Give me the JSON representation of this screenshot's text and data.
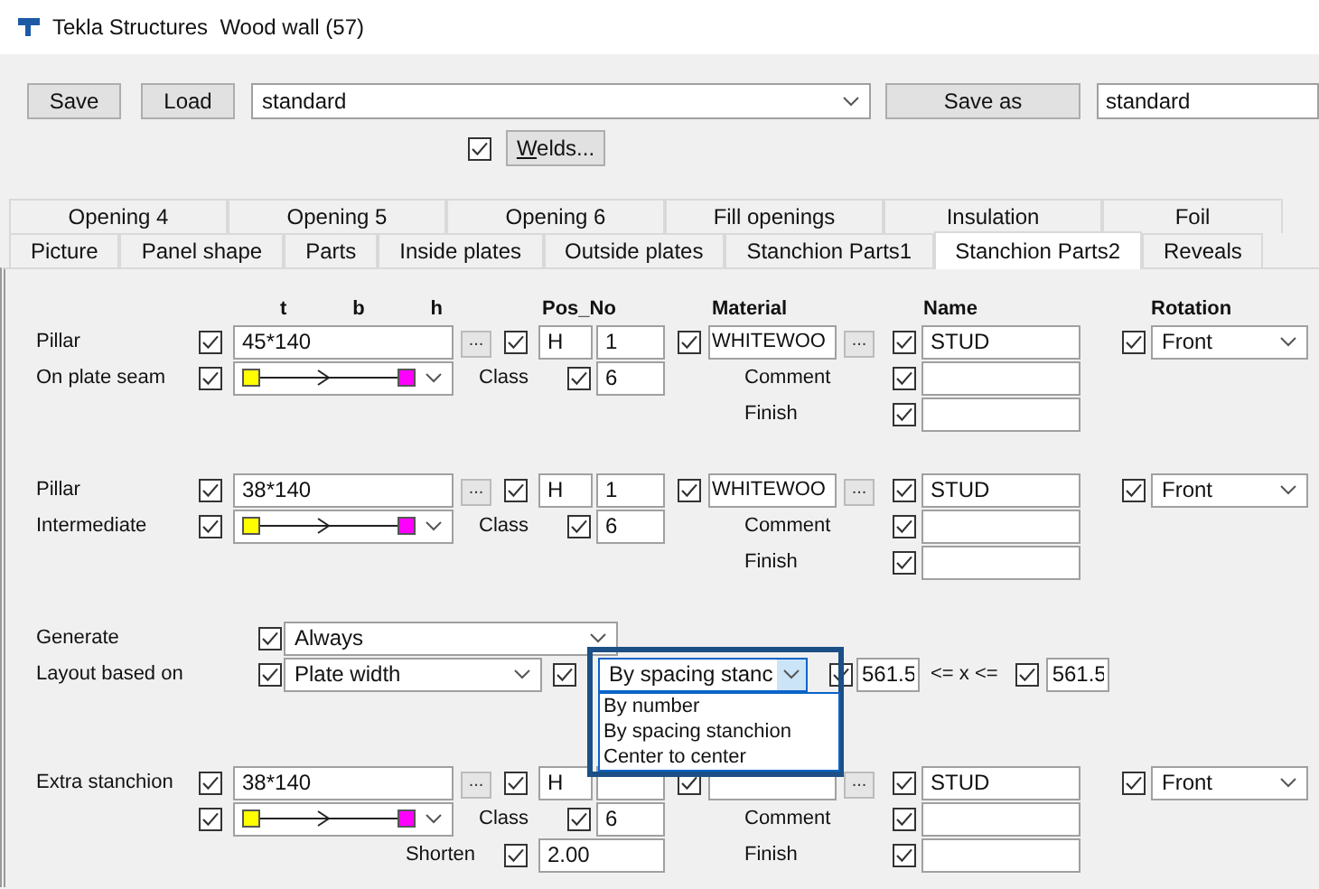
{
  "window": {
    "title": "Tekla Structures  Wood wall (57)"
  },
  "toolbar": {
    "save": "Save",
    "load": "Load",
    "preset": "standard",
    "save_as": "Save as",
    "save_as_name": "standard",
    "welds": {
      "checked": true,
      "label": "Welds..."
    }
  },
  "tab_rows": [
    {
      "tabs": [
        {
          "label": "Opening 4",
          "selected": false
        },
        {
          "label": "Opening 5",
          "selected": false
        },
        {
          "label": "Opening 6",
          "selected": false
        },
        {
          "label": "Fill openings",
          "selected": false
        },
        {
          "label": "Insulation",
          "selected": false
        },
        {
          "label": "Foil",
          "selected": false
        }
      ]
    },
    {
      "tabs": [
        {
          "label": "Picture",
          "selected": false
        },
        {
          "label": "Panel shape",
          "selected": false
        },
        {
          "label": "Parts",
          "selected": false
        },
        {
          "label": "Inside plates",
          "selected": false
        },
        {
          "label": "Outside plates",
          "selected": false
        },
        {
          "label": "Stanchion Parts1",
          "selected": false
        },
        {
          "label": "Stanchion Parts2",
          "selected": true
        },
        {
          "label": "Reveals",
          "selected": false
        }
      ]
    }
  ],
  "column_headers": {
    "profile": [
      "t",
      "b",
      "h"
    ],
    "pos": "Pos_No",
    "material": "Material",
    "name": "Name",
    "rotation": "Rotation"
  },
  "members": [
    {
      "label_lines": [
        "Pillar",
        "On plate seam"
      ],
      "profile": {
        "value": "45*140",
        "checked": true,
        "browse": "..."
      },
      "direction": {
        "checked": true
      },
      "pos_prefix": {
        "value": "H",
        "checked": true
      },
      "pos_no": {
        "value": "1"
      },
      "class": {
        "label": "Class",
        "value": "6",
        "checked": true
      },
      "material": {
        "value": "WHITEWOO",
        "checked": true,
        "browse": "..."
      },
      "name": {
        "value": "STUD",
        "checked": true
      },
      "comment": {
        "label": "Comment",
        "checked": true
      },
      "finish": {
        "label": "Finish",
        "checked": true
      },
      "rotation": {
        "value": "Front",
        "checked": true
      }
    },
    {
      "label_lines": [
        "Pillar",
        "Intermediate"
      ],
      "profile": {
        "value": "38*140",
        "checked": true,
        "browse": "..."
      },
      "direction": {
        "checked": true
      },
      "pos_prefix": {
        "value": "H",
        "checked": true
      },
      "pos_no": {
        "value": "1"
      },
      "class": {
        "label": "Class",
        "value": "6",
        "checked": true
      },
      "material": {
        "value": "WHITEWOO",
        "checked": true,
        "browse": "..."
      },
      "name": {
        "value": "STUD",
        "checked": true
      },
      "comment": {
        "label": "Comment",
        "checked": true
      },
      "finish": {
        "label": "Finish",
        "checked": true
      },
      "rotation": {
        "value": "Front",
        "checked": true
      }
    },
    {
      "label_lines": [
        "Extra stanchion"
      ],
      "profile": {
        "value": "38*140",
        "checked": true,
        "browse": "..."
      },
      "direction": {
        "checked": true
      },
      "pos_prefix": {
        "value": "H",
        "checked": true
      },
      "class": {
        "label": "Class",
        "value": "6",
        "checked": true
      },
      "material": {
        "checked": true,
        "browse": "..."
      },
      "name": {
        "value": "STUD",
        "checked": true
      },
      "comment": {
        "label": "Comment",
        "checked": true
      },
      "finish": {
        "label": "Finish",
        "checked": true
      },
      "rotation": {
        "value": "Front",
        "checked": true
      },
      "shorten": {
        "label": "Shorten",
        "value": "2.00",
        "checked": true
      }
    }
  ],
  "generate": {
    "label": "Generate",
    "checked": true,
    "value": "Always"
  },
  "layout": {
    "label": "Layout based on",
    "checked": true,
    "value": "Plate width",
    "method": {
      "checked": true,
      "value": "By spacing stanc",
      "expanded": true,
      "options": [
        {
          "label": "By number",
          "selected": false
        },
        {
          "label": "By spacing stanchion",
          "selected": false
        },
        {
          "label": "Center to center",
          "selected": false
        }
      ]
    },
    "min": {
      "checked": true,
      "value": "561.5"
    },
    "relation": "<= x <=",
    "max": {
      "checked": true,
      "value": "561.5"
    }
  }
}
